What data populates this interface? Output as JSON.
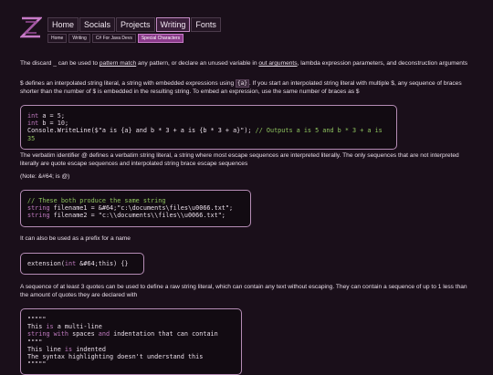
{
  "nav": {
    "items": [
      "Home",
      "Socials",
      "Projects",
      "Writing",
      "Fonts"
    ],
    "active_index": 3
  },
  "breadcrumbs": [
    "Home",
    "Writing",
    "C# For Java Devs",
    "Special Characters"
  ],
  "content": {
    "p1": {
      "pre1": "The discard _ can be used to ",
      "link1": "pattern match",
      "pre2": " any pattern, or declare an unused variable in ",
      "link2": "out arguments",
      "post": ", lambda expression parameters, and deconstruction arguments"
    },
    "p2": {
      "pre": "$ defines an interpolated string literal, a string with embedded expressions using ",
      "inline": "{a}",
      "post": ". If you start an interpolated string literal with multiple $, any sequence of braces shorter than the number of $ is embedded in the resulting string. To embed an expression, use the same number of braces as $"
    },
    "code1": [
      "int a = 5;",
      "int b = 10;",
      "Console.WriteLine($\"a is {a} and b * 3 + a is {b * 3 + a}\"); // Outputs a is 5 and b * 3 + a is 35"
    ],
    "p3": "The verbatim identifier @ defines a verbatim string literal, a string where most escape sequences are interpreted literally. The only sequences that are not interpreted literally are quote escape sequences and interpolated string brace escape sequences",
    "p4": "(Note: &#64; is @)",
    "code2": [
      "// These both produce the same string",
      "string filename1 = &#64;\"c:\\documents\\files\\u0066.txt\";",
      "string filename2 = \"c:\\\\documents\\\\files\\\\u0066.txt\";"
    ],
    "p5": "It can also be used as a prefix for a name",
    "code3": "extension(int &#64;this) {}",
    "p6": "A sequence of at least 3 quotes can be used to define a raw string literal, which can contain any text without escaping. They can contain a sequence of up to 1 less than the amount of quotes they are declared with",
    "code4": [
      "\"\"\"\"\"",
      "This is a multi-line",
      "string with spaces and indentation that can contain \"\"\"\"",
      "      This line is indented",
      "The syntax highlighting doesn't understand this",
      "\"\"\"\"\""
    ]
  },
  "colors": {
    "background": "#1a0f1a",
    "accent": "#8a3a8a",
    "code_border": "#b58cb5",
    "comment": "#8fc45f"
  }
}
